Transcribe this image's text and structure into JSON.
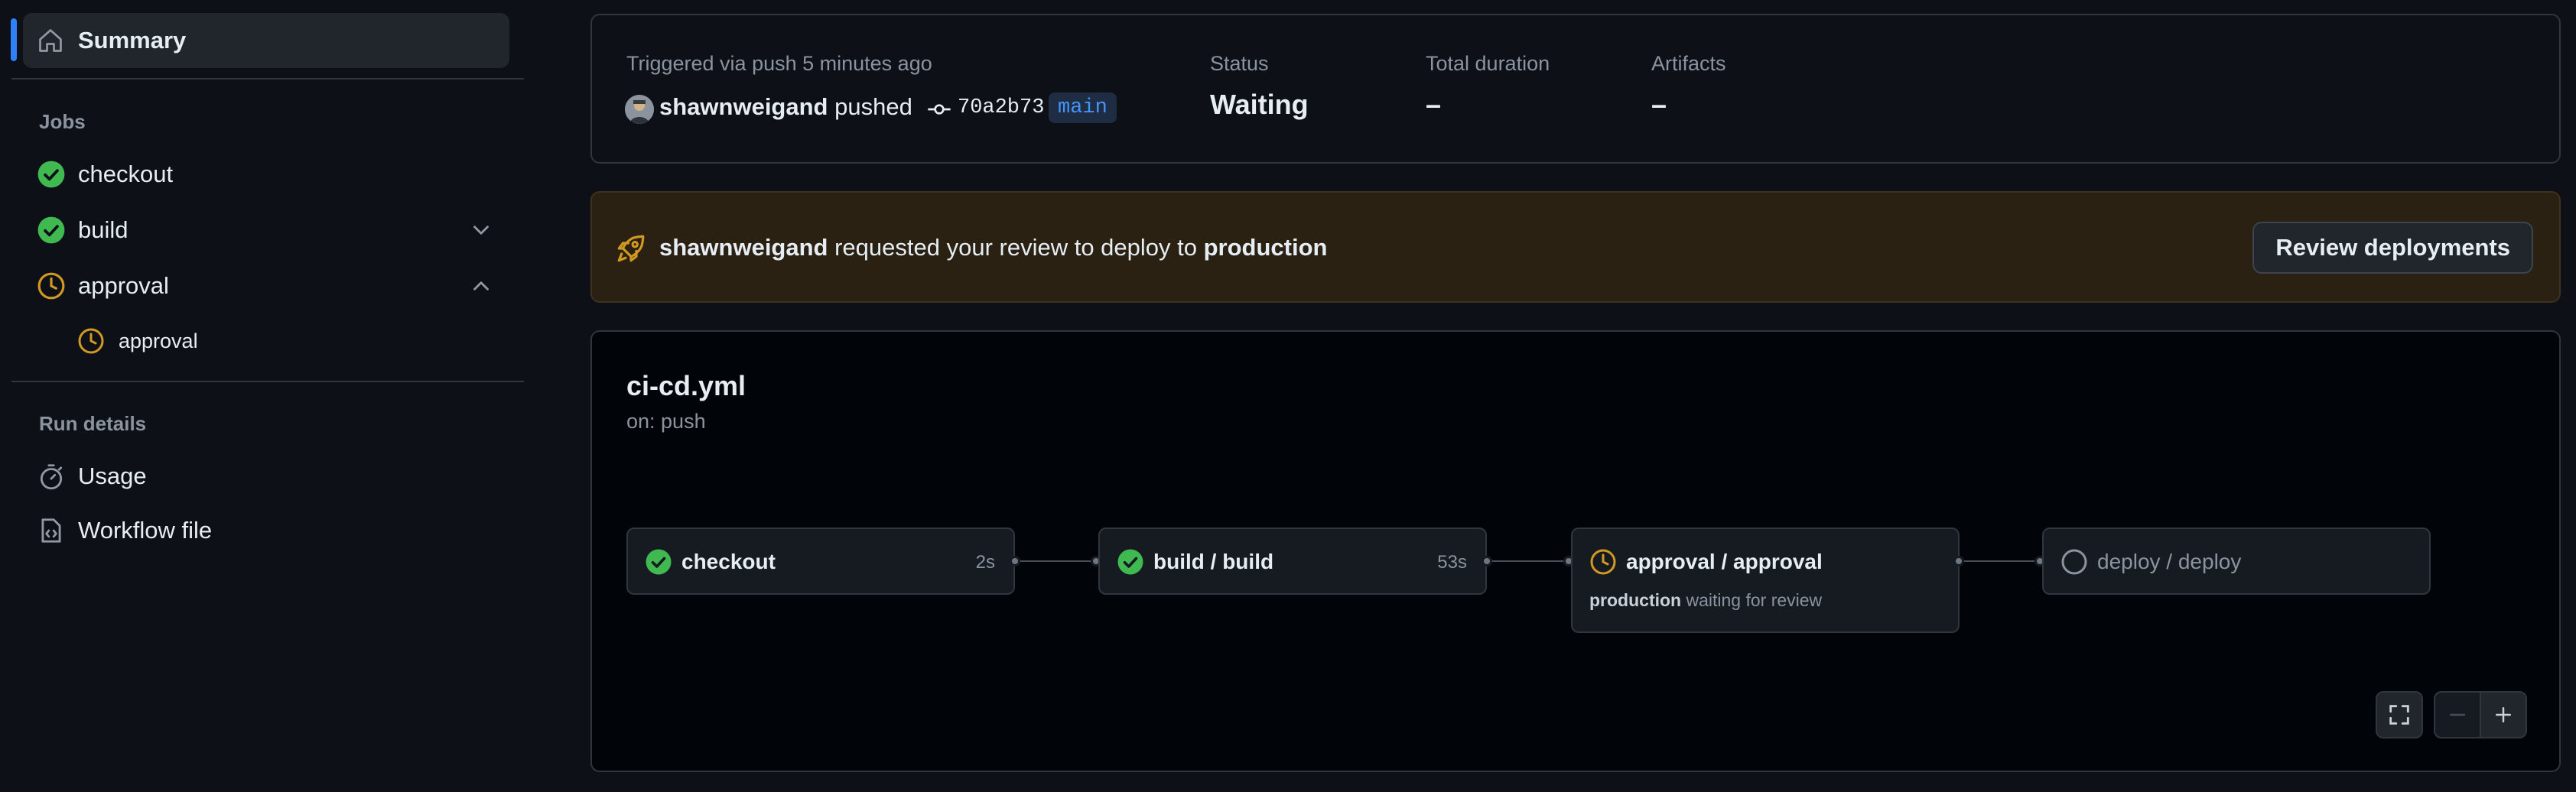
{
  "sidebar": {
    "summary_label": "Summary",
    "jobs_heading": "Jobs",
    "jobs": [
      {
        "label": "checkout",
        "status": "success"
      },
      {
        "label": "build",
        "status": "success"
      },
      {
        "label": "approval",
        "status": "waiting"
      }
    ],
    "approval_subitem": "approval",
    "run_details_heading": "Run details",
    "usage_label": "Usage",
    "workflow_file_label": "Workflow file"
  },
  "run_info": {
    "trigger_text": "Triggered via push 5 minutes ago",
    "actor": "shawnweigand",
    "action": "pushed",
    "commit_sha": "70a2b73",
    "branch": "main",
    "status_label": "Status",
    "status_value": "Waiting",
    "duration_label": "Total duration",
    "duration_value": "–",
    "artifacts_label": "Artifacts",
    "artifacts_value": "–"
  },
  "review_banner": {
    "actor": "shawnweigand",
    "message": " requested your review to deploy to ",
    "environment": "production",
    "button_label": "Review deployments"
  },
  "workflow": {
    "file": "ci-cd.yml",
    "trigger": "on: push",
    "nodes": [
      {
        "name": "checkout",
        "duration": "2s",
        "status": "success"
      },
      {
        "name": "build / build",
        "duration": "53s",
        "status": "success"
      },
      {
        "name": "approval / approval",
        "status": "waiting",
        "note_env": "production",
        "note_text": " waiting for review"
      },
      {
        "name": "deploy / deploy",
        "status": "pending"
      }
    ]
  },
  "colors": {
    "success": "#3fb950",
    "waiting": "#d29922",
    "accent": "#2f81f7",
    "banner_bg": "#2b2112"
  }
}
